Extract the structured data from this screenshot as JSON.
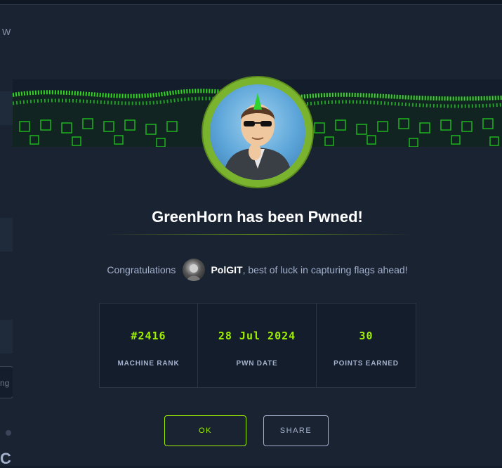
{
  "background": {
    "left_text": "W",
    "input_text": "ng",
    "big_text": "C"
  },
  "modal": {
    "title": "GreenHorn has been Pwned!",
    "congrats_prefix": "Congratulations",
    "username": "PolGIT",
    "congrats_suffix": ", best of luck in capturing flags ahead!",
    "stats": [
      {
        "value": "#2416",
        "label": "MACHINE RANK"
      },
      {
        "value": "28 Jul 2024",
        "label": "PWN DATE"
      },
      {
        "value": "30",
        "label": "POINTS EARNED"
      }
    ],
    "buttons": {
      "ok": "OK",
      "share": "SHARE"
    }
  },
  "colors": {
    "accent": "#9fef00",
    "background": "#141d2b",
    "panel": "#1a2332",
    "text_muted": "#a4b1cd"
  }
}
